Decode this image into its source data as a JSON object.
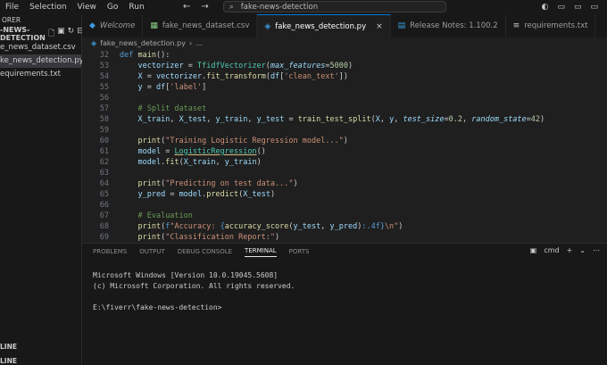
{
  "menu": [
    "File",
    "Selection",
    "View",
    "Go",
    "Run"
  ],
  "search": {
    "text": "fake-news-detection"
  },
  "sidebar": {
    "header": "ORER",
    "project": "-NEWS-DETECTION",
    "files": [
      {
        "name": "e_news_dataset.csv",
        "active": false
      },
      {
        "name": "ke_news_detection.py",
        "active": true
      },
      {
        "name": "equirements.txt",
        "active": false
      }
    ],
    "bottom": [
      "LINE",
      "LINE"
    ]
  },
  "tabs": [
    {
      "label": "Welcome",
      "icon": "vscode-icon",
      "active": false
    },
    {
      "label": "fake_news_dataset.csv",
      "icon": "csv-icon",
      "active": false
    },
    {
      "label": "fake_news_detection.py",
      "icon": "python-icon",
      "active": true
    },
    {
      "label": "Release Notes: 1.100.2",
      "icon": "notes-icon",
      "active": false
    },
    {
      "label": "requirements.txt",
      "icon": "text-file-icon",
      "active": false
    }
  ],
  "breadcrumb": {
    "file": "fake_news_detection.py",
    "scope": "..."
  },
  "editor": {
    "lines": [
      {
        "n": "32",
        "html": "<span class='kw'>def</span> <span class='fn'>main</span>():"
      },
      {
        "n": "53",
        "html": "    <span class='var'>vectorizer</span> = <span class='cls'>TfidfVectorizer</span>(<span class='prm'>max_features</span>=<span class='num'>5000</span>)"
      },
      {
        "n": "54",
        "html": "    <span class='var'>X</span> = <span class='var'>vectorizer</span>.<span class='fn'>fit_transform</span>(<span class='var'>df</span>[<span class='str'>'clean_text'</span>])"
      },
      {
        "n": "55",
        "html": "    <span class='var'>y</span> = <span class='var'>df</span>[<span class='str'>'label'</span>]"
      },
      {
        "n": "56",
        "html": ""
      },
      {
        "n": "57",
        "html": "    <span class='cmt'># Split dataset</span>"
      },
      {
        "n": "58",
        "html": "    <span class='var'>X_train</span>, <span class='var'>X_test</span>, <span class='var'>y_train</span>, <span class='var'>y_test</span> = <span class='fn'>train_test_split</span>(<span class='var'>X</span>, <span class='var'>y</span>, <span class='prm'>test_size</span>=<span class='num'>0.2</span>, <span class='prm'>random_state</span>=<span class='num'>42</span>)"
      },
      {
        "n": "59",
        "html": ""
      },
      {
        "n": "60",
        "html": "    <span class='fn'>print</span>(<span class='str'>\"Training Logistic Regression model...\"</span>)"
      },
      {
        "n": "61",
        "html": "    <span class='var'>model</span> = <span class='cls ul'>LogisticRegression</span>()"
      },
      {
        "n": "62",
        "html": "    <span class='var'>model</span>.<span class='fn'>fit</span>(<span class='var'>X_train</span>, <span class='var'>y_train</span>)"
      },
      {
        "n": "63",
        "html": ""
      },
      {
        "n": "64",
        "html": "    <span class='fn'>print</span>(<span class='str'>\"Predicting on test data...\"</span>)"
      },
      {
        "n": "65",
        "html": "    <span class='var'>y_pred</span> = <span class='var'>model</span>.<span class='fn'>predict</span>(<span class='var'>X_test</span>)"
      },
      {
        "n": "66",
        "html": ""
      },
      {
        "n": "67",
        "html": "    <span class='cmt'># Evaluation</span>"
      },
      {
        "n": "68",
        "html": "    <span class='fn'>print</span>(<span class='kw'>f</span><span class='str'>\"Accuracy: </span><span class='kw'>{</span><span class='fn'>accuracy_score</span>(<span class='var'>y_test</span>, <span class='var'>y_pred</span>)<span class='kw'>:.4f}</span><span class='str'>\\n\"</span>)"
      },
      {
        "n": "69",
        "html": "    <span class='fn'>print</span>(<span class='str'>\"Classification Report:\"</span>)"
      }
    ]
  },
  "panel": {
    "tabs": [
      {
        "label": "PROBLEMS",
        "active": false
      },
      {
        "label": "OUTPUT",
        "active": false
      },
      {
        "label": "DEBUG CONSOLE",
        "active": false
      },
      {
        "label": "TERMINAL",
        "active": true
      },
      {
        "label": "PORTS",
        "active": false
      }
    ],
    "shell": "cmd",
    "terminal_lines": [
      "Microsoft Windows [Version 10.0.19045.5608]",
      "(c) Microsoft Corporation. All rights reserved.",
      "",
      "E:\\fiverr\\fake-news-detection>"
    ]
  }
}
